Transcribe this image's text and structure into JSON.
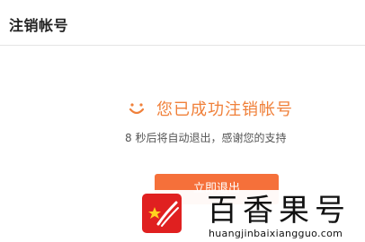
{
  "header": {
    "title": "注销帐号"
  },
  "status": {
    "icon": "smile-icon",
    "accent_color": "#f0803a",
    "message": "您已成功注销帐号",
    "redirect_message": "8 秒后将自动退出，感谢您的支持"
  },
  "actions": {
    "exit_label": "立即退出",
    "button_color": "#f5703a"
  },
  "watermark": {
    "brand_name": "百香果号",
    "url": "huangjinbaixiangguo.com",
    "logo_icon": "star-logo-icon",
    "logo_color": "#e02020"
  }
}
